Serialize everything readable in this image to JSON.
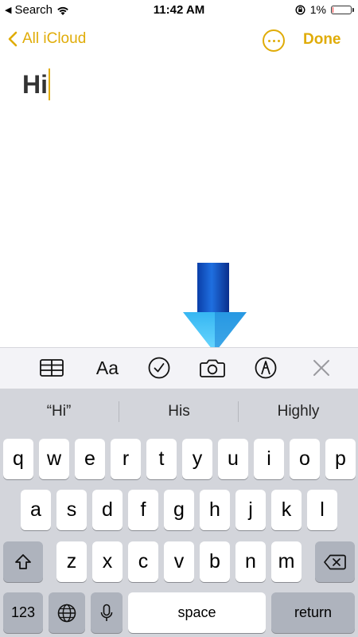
{
  "status_bar": {
    "back_app": "Search",
    "time": "11:42 AM",
    "battery_percent_text": "1%",
    "battery_level": 0.01
  },
  "nav": {
    "back_label": "All iCloud",
    "done_label": "Done",
    "accent_color": "#e0ac08"
  },
  "note": {
    "text": "Hi"
  },
  "toolbar": {
    "items": [
      "table-icon",
      "format-icon",
      "checklist-icon",
      "camera-icon",
      "markup-icon",
      "close-icon"
    ],
    "format_label": "Aa"
  },
  "suggestions": [
    "“Hi”",
    "His",
    "Highly"
  ],
  "keyboard": {
    "row1": [
      "q",
      "w",
      "e",
      "r",
      "t",
      "y",
      "u",
      "i",
      "o",
      "p"
    ],
    "row2": [
      "a",
      "s",
      "d",
      "f",
      "g",
      "h",
      "j",
      "k",
      "l"
    ],
    "row3": [
      "z",
      "x",
      "c",
      "v",
      "b",
      "n",
      "m"
    ],
    "numbers_label": "123",
    "space_label": "space",
    "return_label": "return"
  }
}
